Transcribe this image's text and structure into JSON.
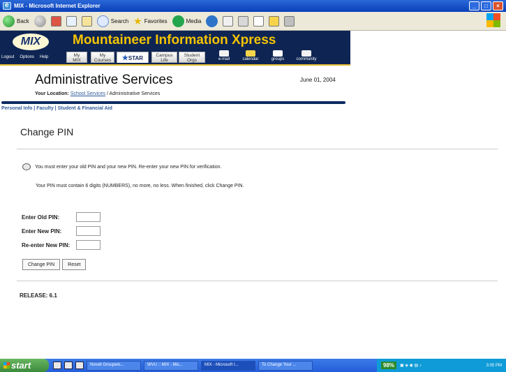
{
  "window": {
    "title": "MIX - Microsoft Internet Explorer",
    "minimize_icon": "minimize-icon",
    "maximize_icon": "maximize-icon",
    "close_icon": "close-icon"
  },
  "toolbar": {
    "back": "Back",
    "search": "Search",
    "favorites": "Favorites",
    "media": "Media"
  },
  "header": {
    "logo": "MIX",
    "brand": "Mountaineer Information Xpress",
    "links": [
      "Logout",
      "Options",
      "Help"
    ],
    "tabs": [
      {
        "label": "My\nMIX"
      },
      {
        "label": "My\nCourses"
      },
      {
        "label": "STAR"
      },
      {
        "label": "Campus\nLife"
      },
      {
        "label": "Student\nOrgs"
      }
    ],
    "icon_links": [
      "e-mail",
      "calendar",
      "groups",
      "community"
    ]
  },
  "page": {
    "section_title": "Administrative Services",
    "date": "June 01, 2004",
    "location_label": "Your Location:",
    "location_link": "School Services",
    "location_current": "Administrative Services",
    "subtabs": [
      "Personal Info",
      "Faculty",
      "Student & Financial Aid"
    ],
    "heading": "Change PIN",
    "info": "You must enter your old PIN and your new PIN. Re-enter your new PIN for verification.",
    "info2": "Your PIN must contain 6 digits (NUMBERS), no more, no less. When finished, click Change PIN.",
    "fields": [
      {
        "label": "Enter Old PIN:",
        "value": "",
        "placeholder": ""
      },
      {
        "label": "Enter New PIN:",
        "value": "",
        "placeholder": ""
      },
      {
        "label": "Re-enter New PIN:",
        "value": "",
        "placeholder": ""
      }
    ],
    "buttons": {
      "change": "Change PIN",
      "reset": "Reset"
    },
    "release": "RELEASE: 6.1"
  },
  "taskbar": {
    "start": "start",
    "items": [
      "Novell Groupwis...",
      "WVU :: MIX - Mic...",
      "MIX - Microsoft I...",
      "To Change Your ..."
    ],
    "battery": "98%",
    "clock": "3:05 PM"
  }
}
